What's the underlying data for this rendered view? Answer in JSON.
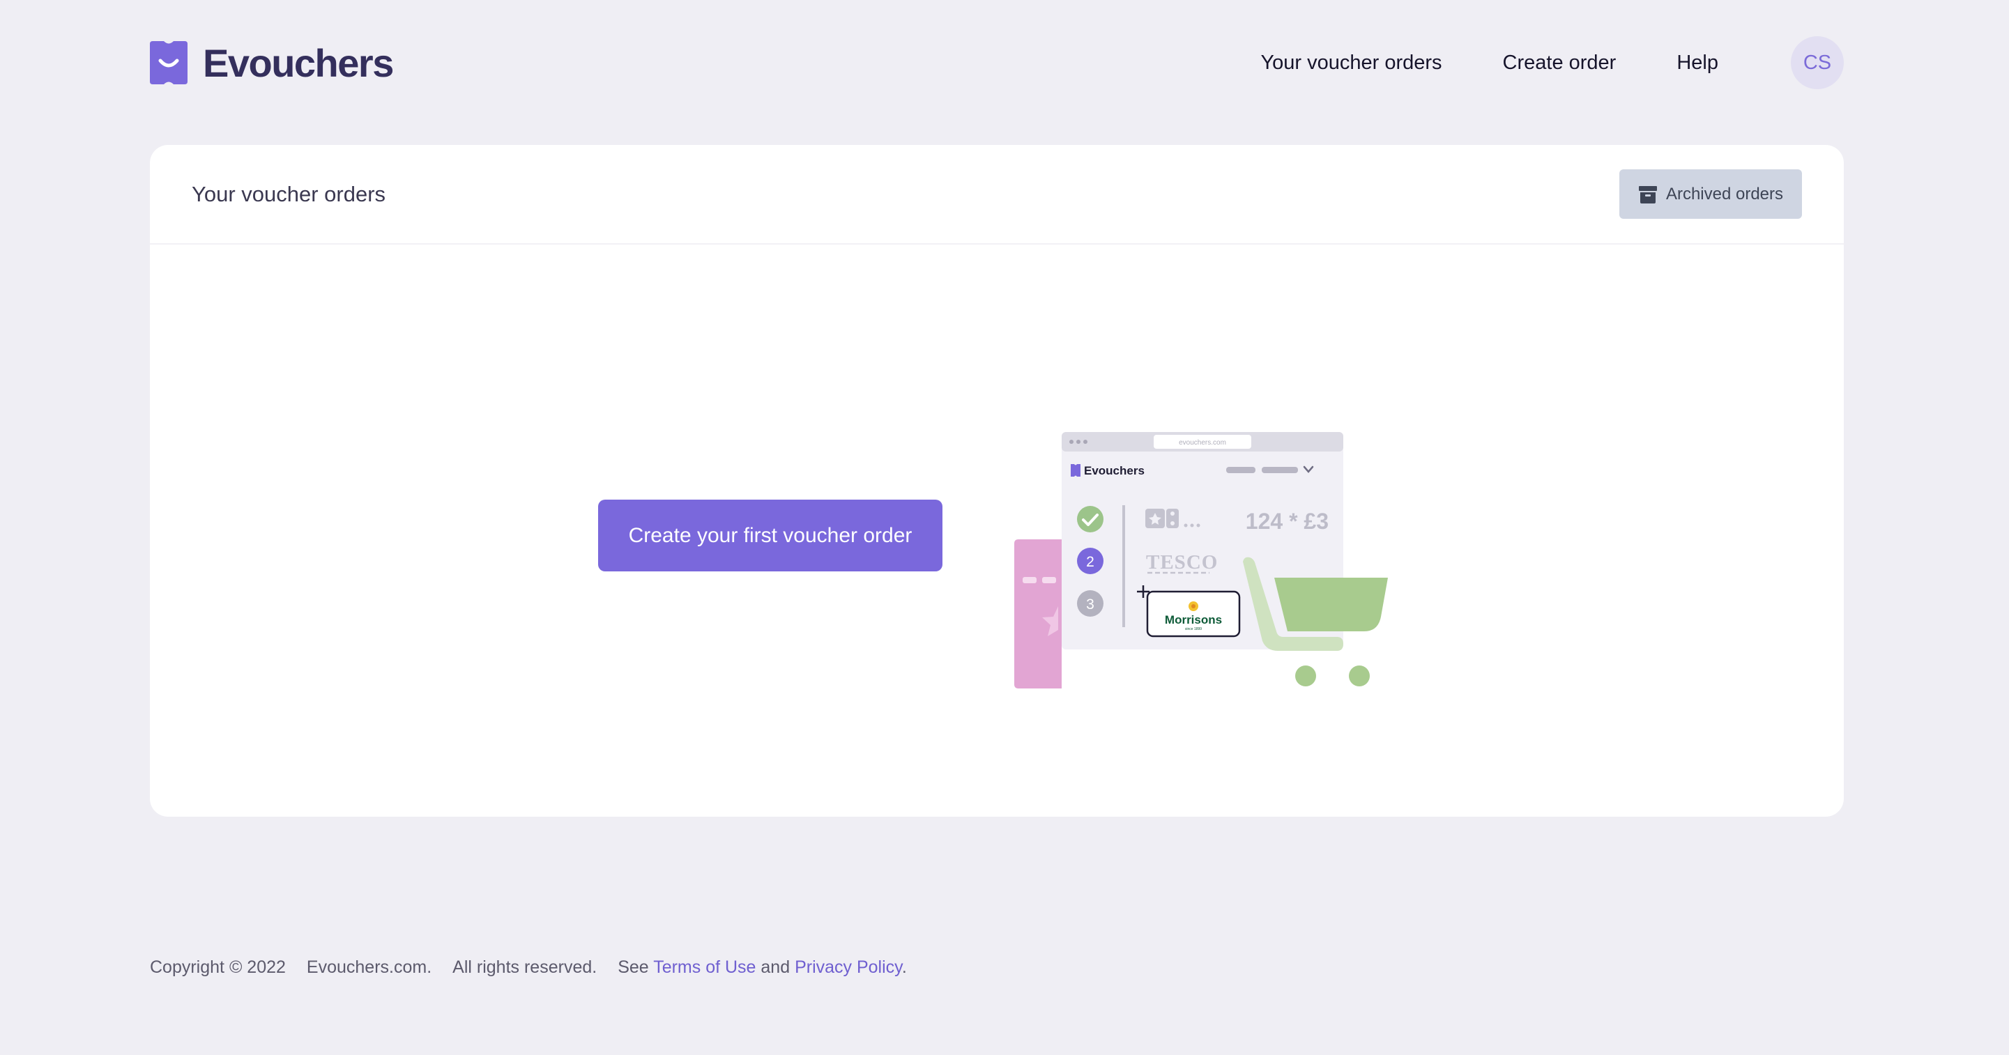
{
  "brand": {
    "name": "Evouchers"
  },
  "nav": {
    "items": [
      "Your voucher orders",
      "Create order",
      "Help"
    ],
    "avatar_initials": "CS"
  },
  "card": {
    "title": "Your voucher orders",
    "archived_label": "Archived orders",
    "create_label": "Create your first voucher order"
  },
  "illustration": {
    "url": "evouchers.com",
    "brand": "Evouchers",
    "step_2": "2",
    "step_3": "3",
    "amount": "124 * £3",
    "tesco": "TESCO",
    "morrisons": "Morrisons",
    "morrisons_sub": "since 1899"
  },
  "footer": {
    "copyright": "Copyright © 2022",
    "site": "Evouchers.com.",
    "rights": "All rights reserved.",
    "see": "See",
    "terms": "Terms of Use",
    "and": "and",
    "privacy": "Privacy Policy",
    "period": "."
  },
  "colors": {
    "accent": "#7a68dc",
    "background": "#efeef4",
    "archived_button": "#cfd5e2",
    "success": "#9cc48a",
    "ticket_pink": "#e2a5d3"
  }
}
